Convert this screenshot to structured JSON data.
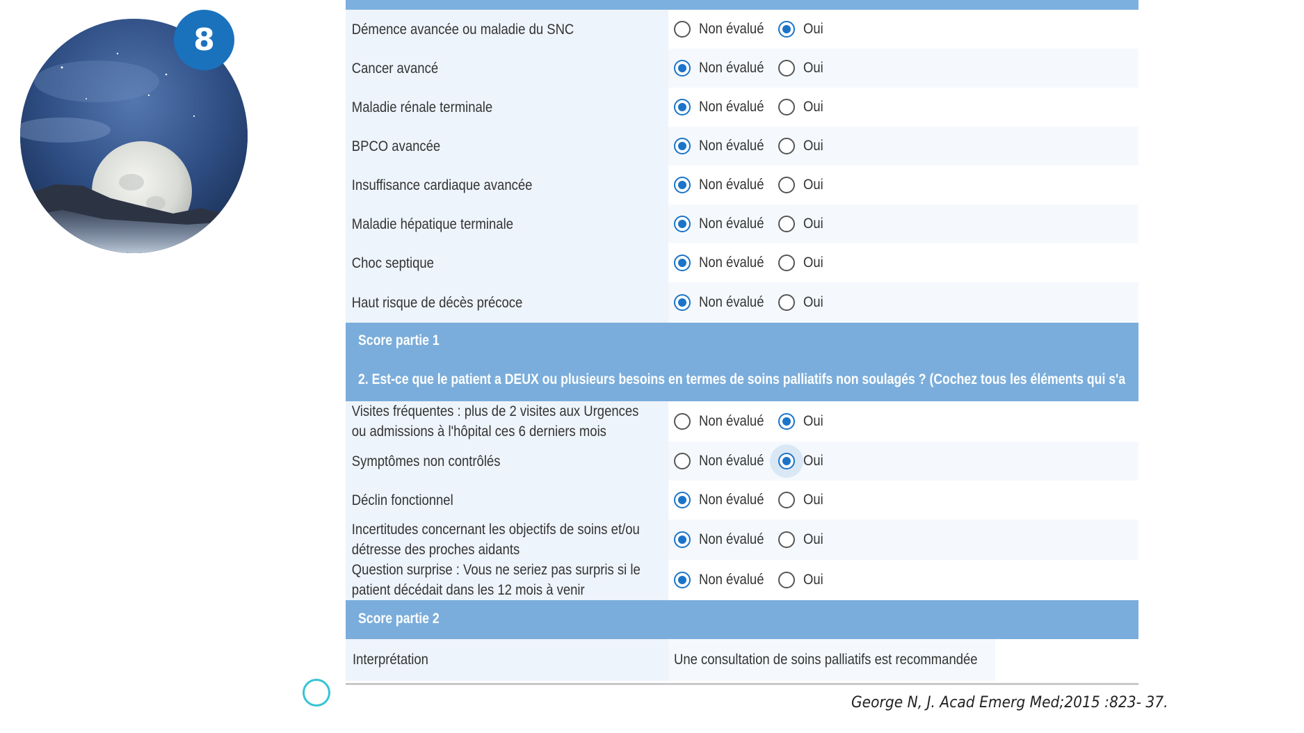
{
  "slide": {
    "badge_number": "8",
    "citation": "George N,  J. Acad Emerg Med;2015  :823- 37."
  },
  "colors": {
    "accent_blue": "#1a72bd",
    "section_header": "#7aaddb",
    "radio_selected": "#1b74c8",
    "ring_cyan": "#35c4d3"
  },
  "form": {
    "option_labels": {
      "not_evaluated": "Non évalué",
      "yes": "Oui"
    },
    "part1_items": [
      {
        "label": "Démence avancée ou maladie du SNC",
        "selected": "yes"
      },
      {
        "label": "Cancer avancé",
        "selected": "not_evaluated"
      },
      {
        "label": "Maladie rénale terminale",
        "selected": "not_evaluated"
      },
      {
        "label": "BPCO avancée",
        "selected": "not_evaluated"
      },
      {
        "label": "Insuffisance cardiaque avancée",
        "selected": "not_evaluated"
      },
      {
        "label": "Maladie hépatique terminale",
        "selected": "not_evaluated"
      },
      {
        "label": "Choc septique",
        "selected": "not_evaluated"
      },
      {
        "label": "Haut risque de décès précoce",
        "selected": "not_evaluated"
      }
    ],
    "score_part1_label": "Score partie 1",
    "question2": "2. Est-ce que le patient a DEUX ou plusieurs besoins en termes de soins palliatifs non soulagés ? (Cochez tous les éléments qui s'a",
    "part2_items": [
      {
        "label_line1": "Visites fréquentes : plus de 2 visites aux Urgences",
        "label_line2": "ou admissions à l'hôpital ces 6 derniers mois",
        "selected": "yes"
      },
      {
        "label_line1": "Symptômes non contrôlés",
        "label_line2": "",
        "selected": "yes"
      },
      {
        "label_line1": "Déclin fonctionnel",
        "label_line2": "",
        "selected": "not_evaluated"
      },
      {
        "label_line1": "Incertitudes concernant les objectifs de soins et/ou",
        "label_line2": "détresse des proches aidants",
        "selected": "not_evaluated"
      },
      {
        "label_line1": "Question surprise : Vous ne seriez pas surpris si le",
        "label_line2": "patient décédait dans les 12 mois à venir",
        "selected": "not_evaluated"
      }
    ],
    "score_part2_label": "Score partie 2",
    "interpretation_label": "Interprétation",
    "interpretation_value": "Une consultation de soins palliatifs est recommandée"
  }
}
